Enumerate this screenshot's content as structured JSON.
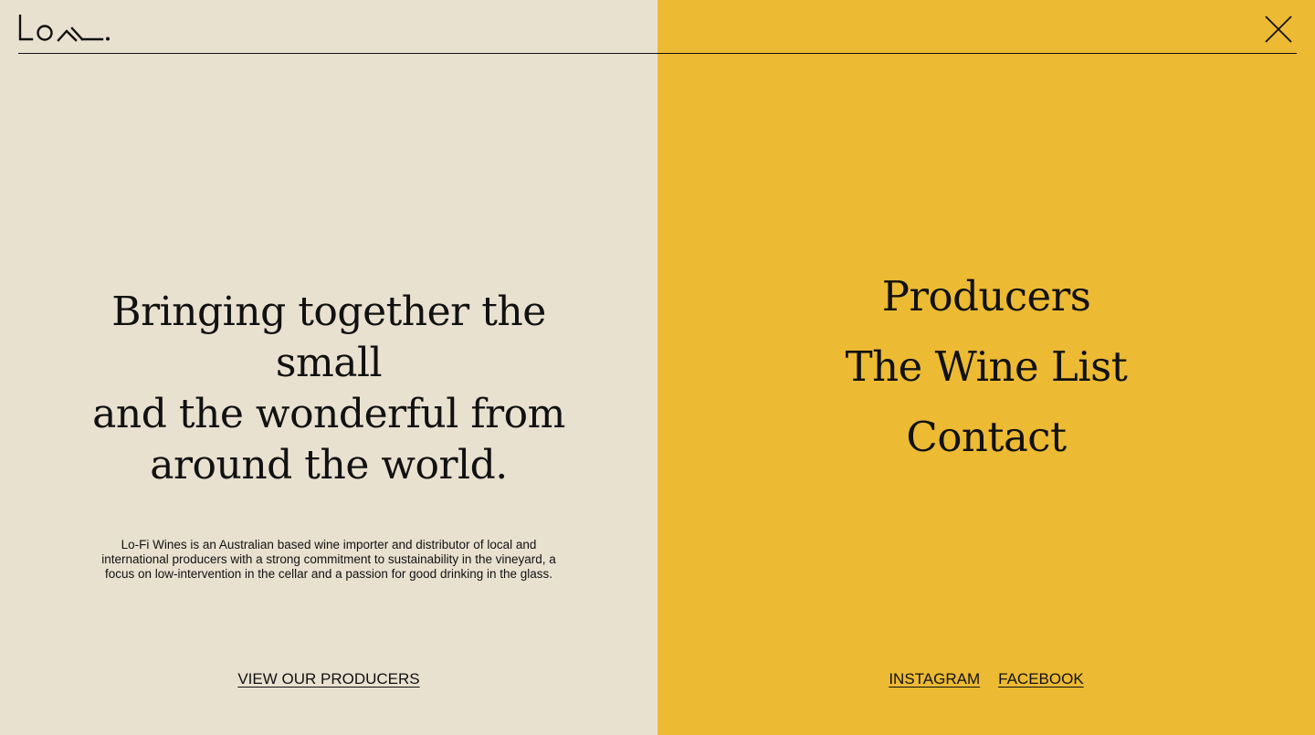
{
  "brand": {
    "logo_icon": "lo-fi-wordmark-logo"
  },
  "header": {
    "close_icon": "close-icon"
  },
  "left_panel": {
    "tagline_lines": [
      "Bringing together the small",
      "and the wonderful from",
      "around the world."
    ],
    "intro": "Lo-Fi Wines is an Australian based wine importer and distributor of local and international producers with a strong commitment to sustainability in the vineyard, a focus on low-intervention in the cellar and a passion for good drinking in the glass.",
    "cta_label": "VIEW OUR PRODUCERS"
  },
  "menu": {
    "items": [
      {
        "label": "Producers"
      },
      {
        "label": "The Wine List"
      },
      {
        "label": "Contact"
      }
    ],
    "social": [
      {
        "label": "INSTAGRAM"
      },
      {
        "label": "FACEBOOK"
      }
    ]
  },
  "colors": {
    "left_background": "#e9e1d0",
    "right_background": "#ecba33",
    "ink": "#111111"
  }
}
